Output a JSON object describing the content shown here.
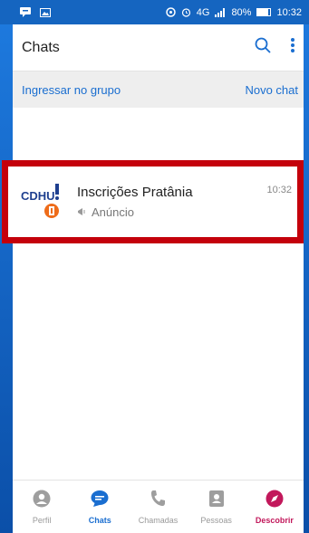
{
  "status": {
    "signal": "4G",
    "battery": "80%",
    "time": "10:32",
    "battery_level": 0.8
  },
  "header": {
    "title": "Chats"
  },
  "subbar": {
    "join_group": "Ingressar no grupo",
    "new_chat": "Novo chat"
  },
  "chats": [
    {
      "name": "Inscrições Pratânia",
      "subtitle": "Anúncio",
      "time": "10:32",
      "avatar_text": "CDHU"
    }
  ],
  "nav": [
    {
      "label": "Perfil"
    },
    {
      "label": "Chats"
    },
    {
      "label": "Chamadas"
    },
    {
      "label": "Pessoas"
    },
    {
      "label": "Descobrir"
    }
  ],
  "colors": {
    "accent": "#1a6ed0",
    "highlight_border": "#c4000b",
    "discover": "#c2185b",
    "statusbar": "#1565c0"
  }
}
